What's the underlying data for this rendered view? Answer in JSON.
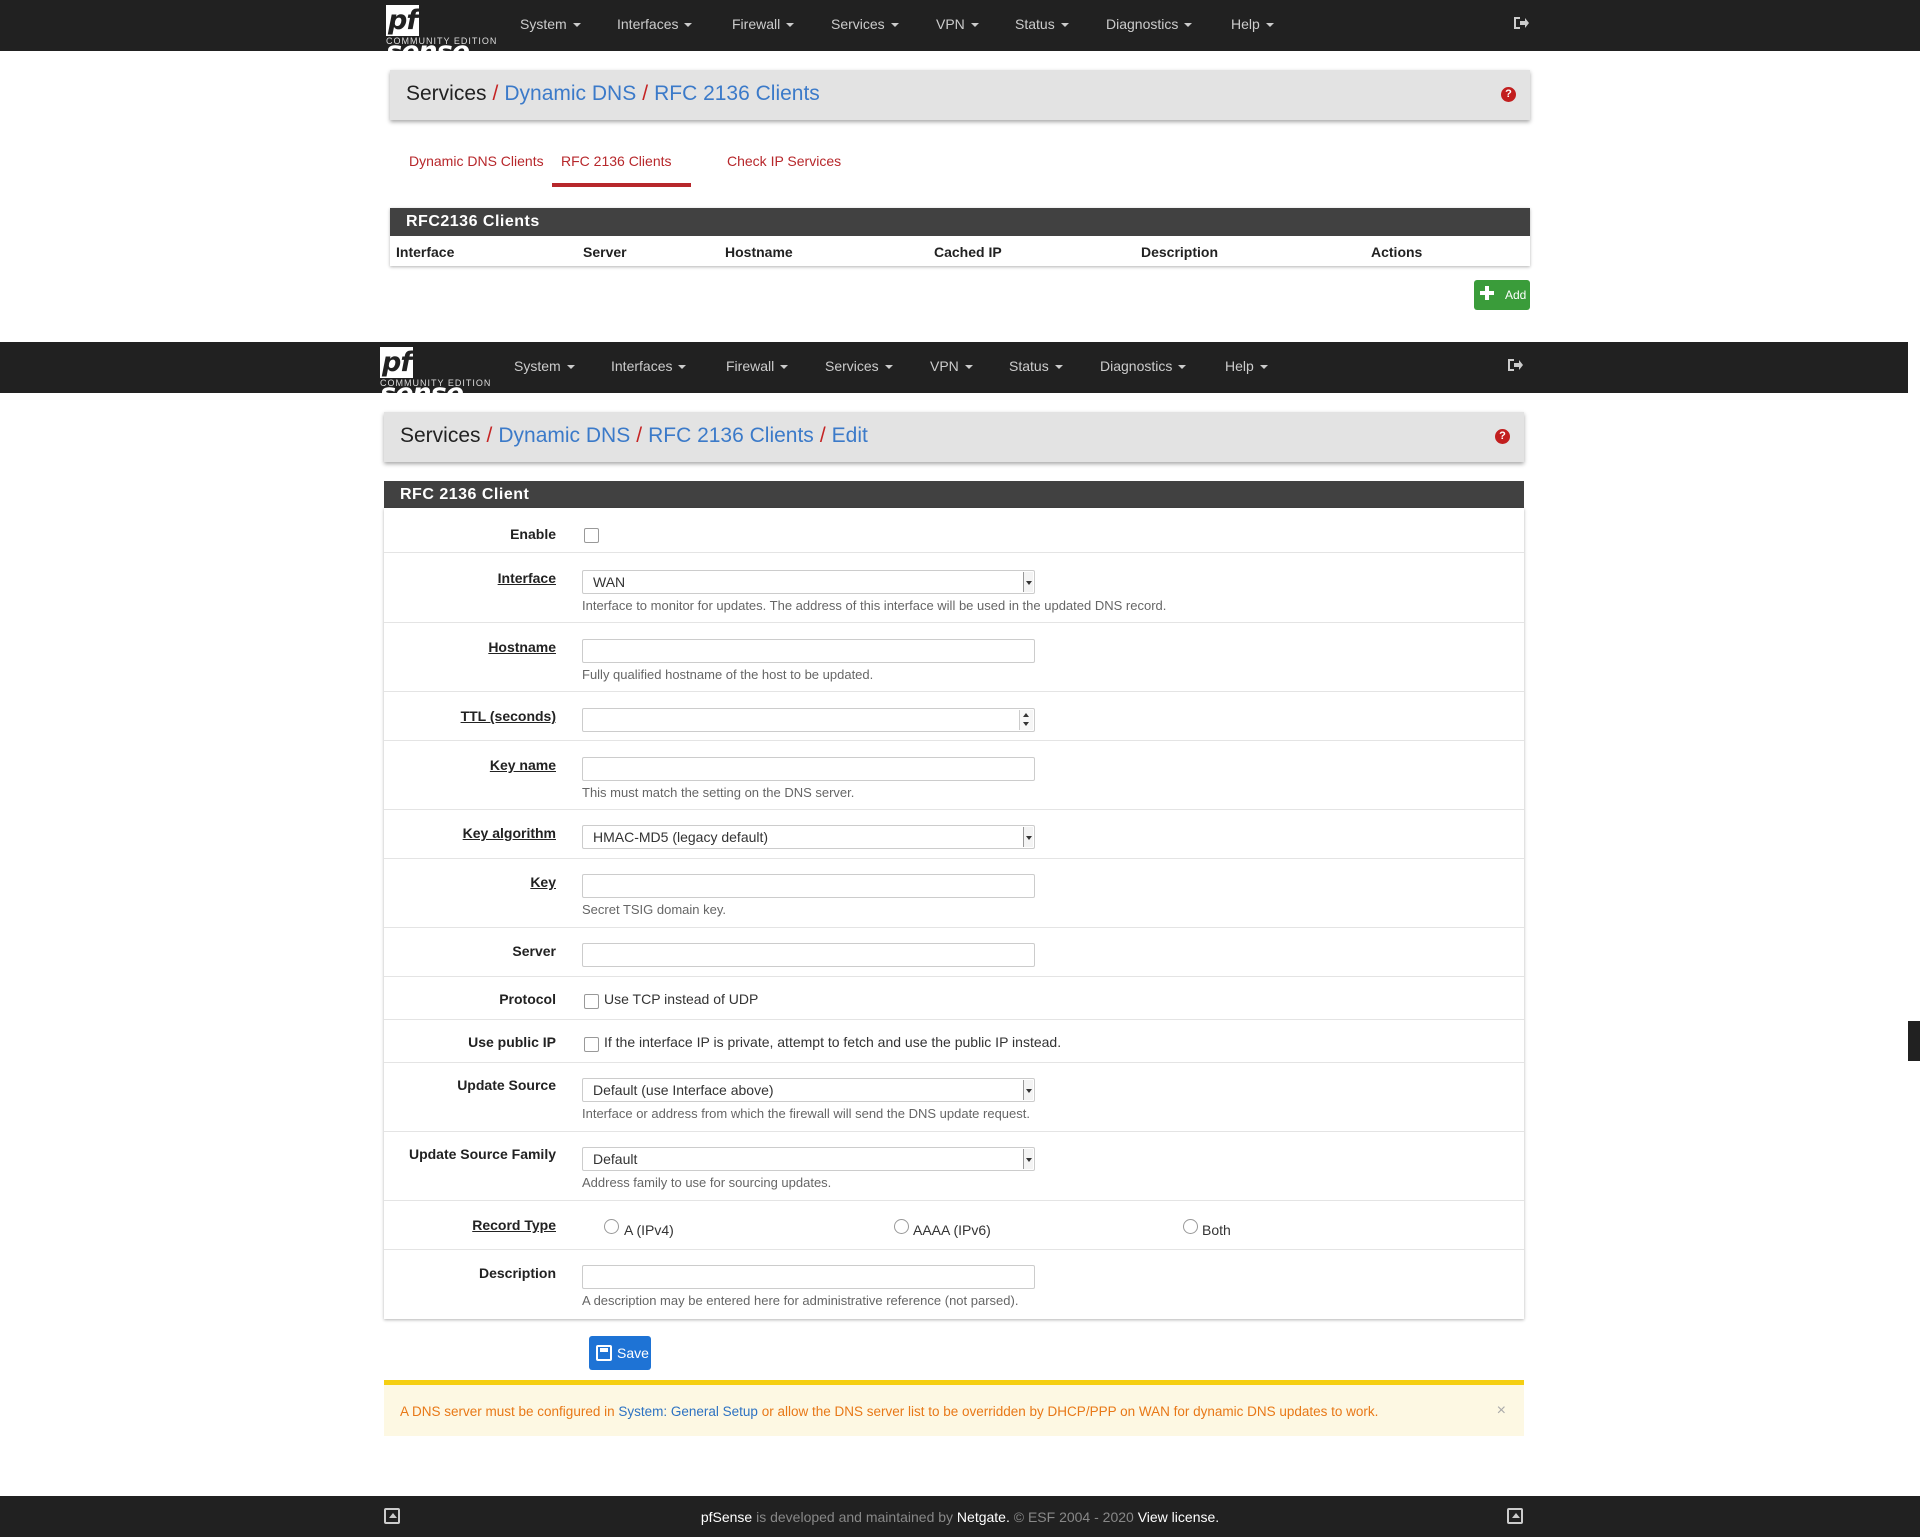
{
  "nav": {
    "brand_pf": "pf",
    "brand_sense": "sense",
    "edition": "COMMUNITY EDITION",
    "items": [
      "System",
      "Interfaces",
      "Firewall",
      "Services",
      "VPN",
      "Status",
      "Diagnostics",
      "Help"
    ]
  },
  "list_page": {
    "breadcrumb": {
      "root": "Services",
      "link1": "Dynamic DNS",
      "link2": "RFC 2136 Clients"
    },
    "tabs": [
      "Dynamic DNS Clients",
      "RFC 2136 Clients",
      "Check IP Services"
    ],
    "active_tab": "RFC 2136 Clients",
    "panel_title": "RFC2136 Clients",
    "columns": [
      "Interface",
      "Server",
      "Hostname",
      "Cached IP",
      "Description",
      "Actions"
    ],
    "add_label": "Add"
  },
  "edit_page": {
    "breadcrumb": {
      "root": "Services",
      "link1": "Dynamic DNS",
      "link2": "RFC 2136 Clients",
      "link3": "Edit"
    },
    "panel_title": "RFC 2136 Client",
    "fields": {
      "enable": {
        "label": "Enable"
      },
      "interface": {
        "label": "Interface",
        "value": "WAN",
        "help": "Interface to monitor for updates. The address of this interface will be used in the updated DNS record."
      },
      "hostname": {
        "label": "Hostname",
        "value": "",
        "help": "Fully qualified hostname of the host to be updated."
      },
      "ttl": {
        "label": "TTL (seconds)",
        "value": ""
      },
      "keyname": {
        "label": "Key name",
        "value": "",
        "help": "This must match the setting on the DNS server."
      },
      "keyalgo": {
        "label": "Key algorithm",
        "value": "HMAC-MD5 (legacy default)"
      },
      "key": {
        "label": "Key",
        "value": "",
        "help": "Secret TSIG domain key."
      },
      "server": {
        "label": "Server",
        "value": ""
      },
      "protocol": {
        "label": "Protocol",
        "option": "Use TCP instead of UDP"
      },
      "publicip": {
        "label": "Use public IP",
        "option": "If the interface IP is private, attempt to fetch and use the public IP instead."
      },
      "updatesource": {
        "label": "Update Source",
        "value": "Default (use Interface above)",
        "help": "Interface or address from which the firewall will send the DNS update request."
      },
      "updatefamily": {
        "label": "Update Source Family",
        "value": "Default",
        "help": "Address family to use for sourcing updates."
      },
      "recordtype": {
        "label": "Record Type",
        "options": [
          "A (IPv4)",
          "AAAA (IPv6)",
          "Both"
        ]
      },
      "description": {
        "label": "Description",
        "value": "",
        "help": "A description may be entered here for administrative reference (not parsed)."
      }
    },
    "save_label": "Save",
    "alert": {
      "pre": "A DNS server must be configured in ",
      "link": "System: General Setup",
      "post": " or allow the DNS server list to be overridden by DHCP/PPP on WAN for dynamic DNS updates to work.",
      "close": "×"
    }
  },
  "footer": {
    "product": "pfSense",
    "text1": " is developed and maintained by ",
    "company": "Netgate.",
    "text2": " © ESF 2004 - 2020 ",
    "license": "View license."
  }
}
